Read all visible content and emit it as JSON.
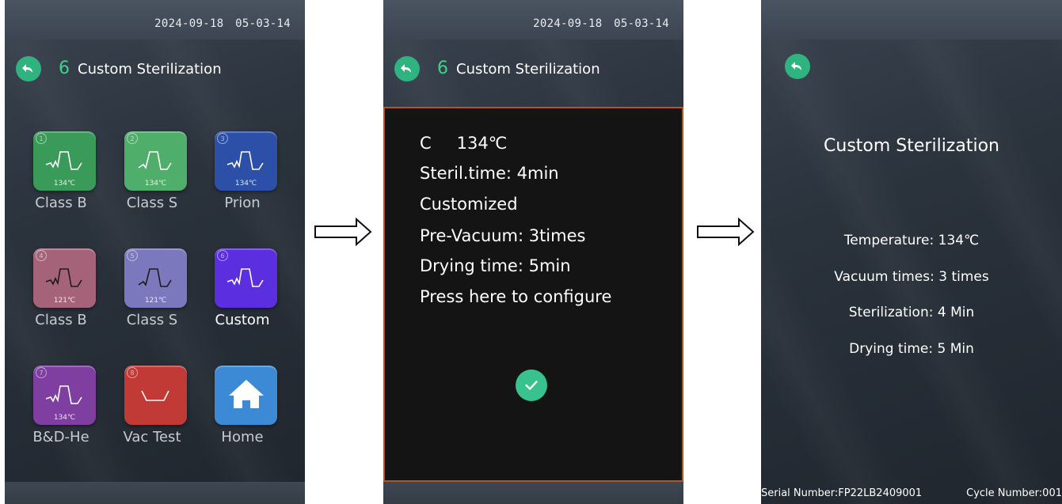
{
  "screen1": {
    "datetime": "2024-09-18  05-03-14",
    "header": {
      "number": "6",
      "title": "Custom Sterilization"
    },
    "tiles": [
      {
        "index": "1",
        "label": "Class B",
        "temp": "134℃",
        "color": "#3a9a5a"
      },
      {
        "index": "2",
        "label": "Class S",
        "temp": "134℃",
        "color": "#4fae6a"
      },
      {
        "index": "3",
        "label": "Prion",
        "temp": "134℃",
        "color": "#2c4fa8"
      },
      {
        "index": "4",
        "label": "Class B",
        "temp": "121℃",
        "color": "#a5637a"
      },
      {
        "index": "5",
        "label": "Class S",
        "temp": "121℃",
        "color": "#7b78bd"
      },
      {
        "index": "6",
        "label": "Custom",
        "temp": "",
        "color": "#5b2ee0"
      },
      {
        "index": "7",
        "label": "B&D-He",
        "temp": "134℃",
        "color": "#7e3fa0"
      },
      {
        "index": "8",
        "label": "Vac Test",
        "temp": "",
        "color": "#c23a36"
      },
      {
        "index": "",
        "label": "Home",
        "temp": "",
        "color": "#3c8ad6"
      }
    ]
  },
  "screen2": {
    "datetime": "2024-09-18  05-03-14",
    "header": {
      "number": "6",
      "title": "Custom Sterilization"
    },
    "popup": {
      "mode": "C",
      "temperature": "134℃",
      "steril_time": "Steril.time:  4min",
      "customized": "Customized",
      "pre_vacuum": "Pre-Vacuum:  3times",
      "drying_time": "Drying time:  5min",
      "configure_hint": "Press here to configure"
    }
  },
  "screen3": {
    "title": "Custom Sterilization",
    "temperature": "Temperature: 134℃",
    "vacuum_times": "Vacuum times: 3 times",
    "sterilization": "Sterilization: 4 Min",
    "drying_time": "Drying time: 5 Min",
    "serial_number": "Serial Number:FP22LB2409001",
    "cycle_number": "Cycle Number:001"
  },
  "colors": {
    "accent_green": "#2fb37f",
    "number_green": "#3fd18c",
    "popup_border": "#b4561e"
  },
  "icons": {
    "back": "back-arrow-icon",
    "ok": "checkmark-icon",
    "home": "house-icon"
  }
}
